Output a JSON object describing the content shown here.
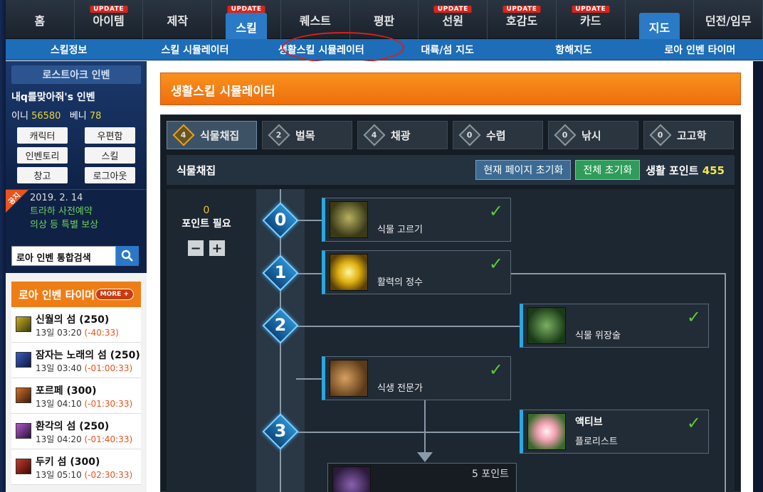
{
  "topnav": [
    {
      "label": "홈",
      "badge": ""
    },
    {
      "label": "아이템",
      "badge": "UPDATE"
    },
    {
      "label": "제작",
      "badge": ""
    },
    {
      "label": "스킬",
      "badge": "UPDATE"
    },
    {
      "label": "퀘스트",
      "badge": ""
    },
    {
      "label": "평판",
      "badge": ""
    },
    {
      "label": "선원",
      "badge": "UPDATE"
    },
    {
      "label": "호감도",
      "badge": "UPDATE"
    },
    {
      "label": "카드",
      "badge": "UPDATE"
    },
    {
      "label": "지도",
      "badge": ""
    },
    {
      "label": "던전/임무",
      "badge": ""
    }
  ],
  "subnav": [
    "스킬정보",
    "스킬 시뮬레이터",
    "생활스킬 시뮬레이터",
    "대륙/섬 지도",
    "항해지도",
    "로아 인벤 타이머"
  ],
  "profile": {
    "title": "로스트아크 인벤",
    "name": "내q를맞아줘's 인벤",
    "inni_label": "이니",
    "inni_value": "56580",
    "beni_label": "베니",
    "beni_value": "78",
    "buttons": [
      "캐릭터",
      "우편함",
      "인벤토리",
      "스킬",
      "창고",
      "로그아웃"
    ]
  },
  "notice": {
    "tag": "공지",
    "date": "2019. 2. 14",
    "line1": "트라하 사전예약",
    "line2": "의상 등 특별 보상"
  },
  "search": {
    "value": "로아 인벤 통합검색"
  },
  "timer": {
    "title": "로아 인벤 타이머",
    "more": "MORE +",
    "rows": [
      {
        "name": "신월의 섬 (250)",
        "time": "13일 03:20",
        "remain": "(-40:33)"
      },
      {
        "name": "잠자는 노래의 섬 (250)",
        "time": "13일 03:40",
        "remain": "(-01:00:33)"
      },
      {
        "name": "포르페 (300)",
        "time": "13일 04:10",
        "remain": "(-01:30:33)"
      },
      {
        "name": "환각의 섬 (250)",
        "time": "13일 04:20",
        "remain": "(-01:40:33)"
      },
      {
        "name": "두키 섬 (300)",
        "time": "13일 05:10",
        "remain": "(-02:30:33)"
      }
    ]
  },
  "main": {
    "banner": "생활스킬 시뮬레이터",
    "tabs": [
      {
        "num": "4",
        "label": "식물채집"
      },
      {
        "num": "2",
        "label": "벌목"
      },
      {
        "num": "4",
        "label": "채광"
      },
      {
        "num": "0",
        "label": "수렵"
      },
      {
        "num": "0",
        "label": "낚시"
      },
      {
        "num": "0",
        "label": "고고학"
      }
    ],
    "bar": {
      "title": "식물채집",
      "reset_page": "현재 페이지 초기화",
      "reset_all": "전체 초기화",
      "points_label": "생활 포인트",
      "points_value": "455"
    },
    "need": {
      "value": "0",
      "label": "포인트 필요",
      "minus": "−",
      "plus": "+"
    },
    "levels": [
      "0",
      "1",
      "2",
      "3"
    ],
    "skills": [
      {
        "name": "식물 고르기",
        "check": "✓"
      },
      {
        "name": "활력의 정수",
        "check": "✓"
      },
      {
        "name": "식물 위장술",
        "check": "✓"
      },
      {
        "name": "식생 전문가",
        "check": "✓"
      },
      {
        "head": "액티브",
        "name": "플로리스트",
        "check": "✓"
      },
      {
        "points": "5 포인트"
      }
    ]
  }
}
